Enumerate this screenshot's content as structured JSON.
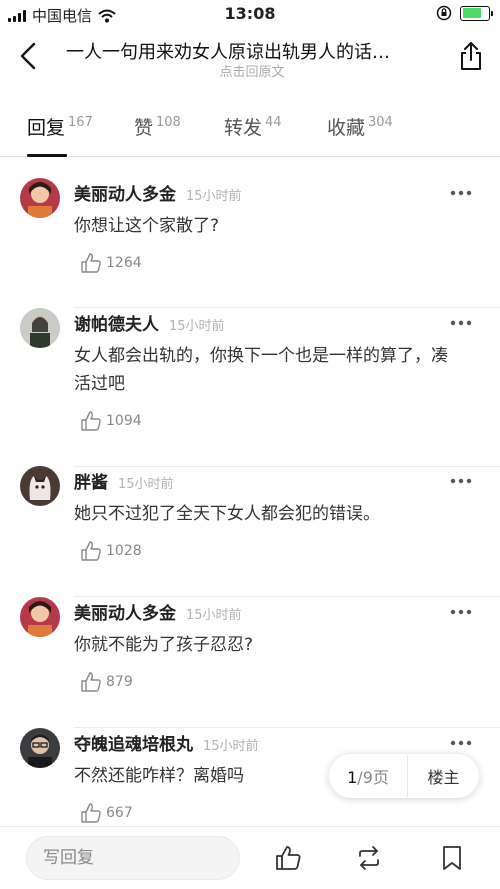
{
  "status_bar": {
    "carrier": "中国电信",
    "time": "13:08"
  },
  "header": {
    "title": "一人一句用来劝女人原谅出轨男人的话…",
    "subtitle": "点击回原文"
  },
  "tabs": [
    {
      "label": "回复",
      "count": "167",
      "active": true
    },
    {
      "label": "赞",
      "count": "108",
      "active": false
    },
    {
      "label": "转发",
      "count": "44",
      "active": false
    },
    {
      "label": "收藏",
      "count": "304",
      "active": false
    }
  ],
  "comments": [
    {
      "name": "美丽动人多金",
      "time": "15小时前",
      "text": "你想让这个家散了?",
      "likes": "1264",
      "avatar": "girl-red"
    },
    {
      "name": "谢帕德夫人",
      "time": "15小时前",
      "text": "女人都会出轨的，你换下一个也是一样的算了，凑活过吧",
      "likes": "1094",
      "avatar": "woman-dark"
    },
    {
      "name": "胖酱",
      "time": "15小时前",
      "text": "她只不过犯了全天下女人都会犯的错误。",
      "likes": "1028",
      "avatar": "cat"
    },
    {
      "name": "美丽动人多金",
      "time": "15小时前",
      "text": "你就不能为了孩子忍忍?",
      "likes": "879",
      "avatar": "girl-red"
    },
    {
      "name": "夺魄追魂培根丸",
      "time": "15小时前",
      "text": "不然还能咋样？离婚吗",
      "likes": "667",
      "avatar": "man-glasses"
    }
  ],
  "pager": {
    "current": "1",
    "total": "/9页",
    "owner_label": "楼主"
  },
  "bottom_bar": {
    "reply_placeholder": "写回复"
  },
  "colors": {
    "battery": "#4cd964",
    "text": "#222222",
    "muted": "#999999"
  }
}
